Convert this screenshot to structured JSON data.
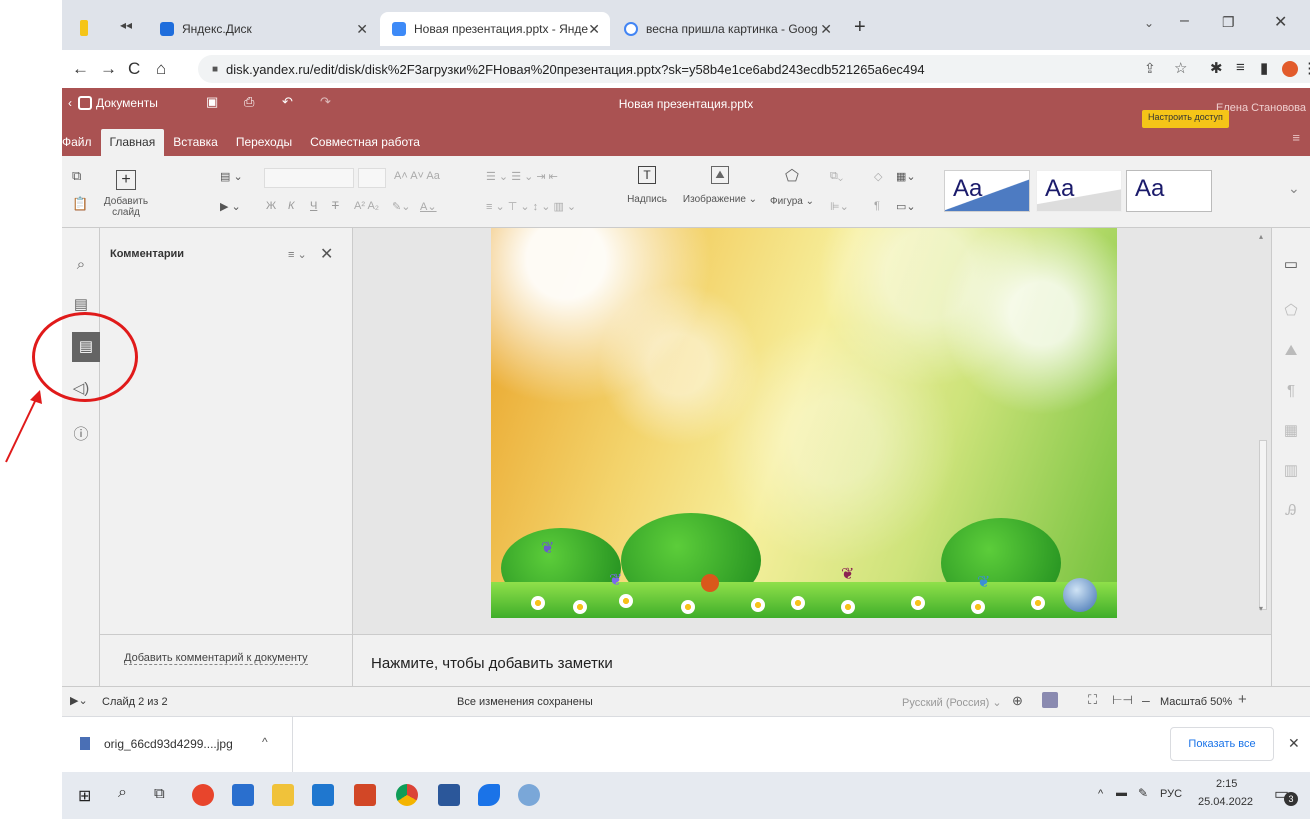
{
  "browser": {
    "tabs": [
      {
        "label": "Яндекс.Диск"
      },
      {
        "label": "Новая презентация.pptx - Янде"
      },
      {
        "label": "весна пришла картинка - Goog"
      }
    ],
    "url": "disk.yandex.ru/edit/disk/disk%2F3агрузки%2FНовая%20презентация.pptx?sk=y58b4e1ce6abd243ecdb521265a6ec494"
  },
  "editor": {
    "app_title": "Документы",
    "doc_title": "Новая презентация.pptx",
    "user_name": "Елена Становова",
    "share_button": "Настроить доступ",
    "tabs": [
      "Файл",
      "Главная",
      "Вставка",
      "Переходы",
      "Совместная работа"
    ],
    "toolbar": {
      "add_slide": "Добавить слайд",
      "caption": "Надпись",
      "image": "Изображение",
      "shape": "Фигура",
      "bold": "Ж",
      "italic": "К",
      "underline": "Ч",
      "strike": "Т",
      "theme_label": "Aa"
    }
  },
  "comments_panel": {
    "title": "Комментарии",
    "add_comment": "Добавить комментарий к документу"
  },
  "notes": {
    "placeholder": "Нажмите, чтобы добавить заметки"
  },
  "statusbar": {
    "slide_counter": "Слайд 2 из 2",
    "save_status": "Все изменения сохранены",
    "language": "Русский (Россия)",
    "zoom": "Масштаб 50%"
  },
  "downloads": {
    "file_name": "orig_66cd93d4299....jpg",
    "show_all": "Показать все"
  },
  "taskbar": {
    "language": "РУС",
    "time": "2:15",
    "date": "25.04.2022",
    "notifications": "3"
  },
  "colors": {
    "accent": "#aa5252",
    "annotation": "#e01a1a"
  }
}
